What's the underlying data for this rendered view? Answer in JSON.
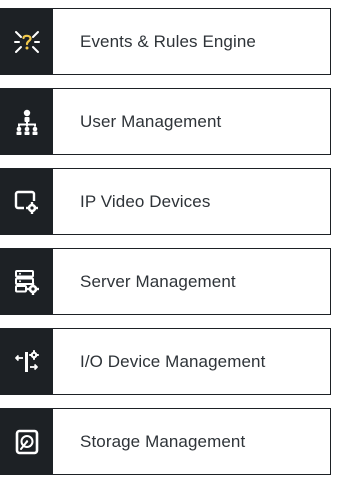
{
  "menu": {
    "items": [
      {
        "label": "Events & Rules Engine",
        "icon": "events-rules-icon"
      },
      {
        "label": "User Management",
        "icon": "org-hierarchy-icon"
      },
      {
        "label": "IP Video Devices",
        "icon": "video-device-gear-icon"
      },
      {
        "label": "Server Management",
        "icon": "server-gear-icon"
      },
      {
        "label": "I/O Device Management",
        "icon": "io-device-gear-icon"
      },
      {
        "label": "Storage Management",
        "icon": "storage-disk-icon"
      }
    ]
  },
  "colors": {
    "tile_background": "#1d2125",
    "icon_color": "#ffffff",
    "accent": "#f2c94c",
    "text": "#2e3338",
    "border": "#1d2125"
  }
}
